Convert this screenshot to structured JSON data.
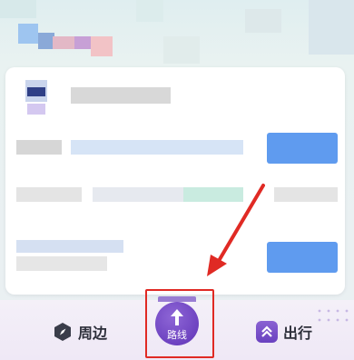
{
  "bottom_nav": {
    "nearby_label": "周边",
    "route_label": "路线",
    "travel_label": "出行"
  },
  "icons": {
    "nearby": "compass-icon",
    "route": "route-arrow-icon",
    "travel": "double-chevron-up-icon"
  },
  "colors": {
    "accent_purple": "#6d42c0",
    "highlight_red": "#e02a24",
    "link_blue": "#4a86ee"
  }
}
